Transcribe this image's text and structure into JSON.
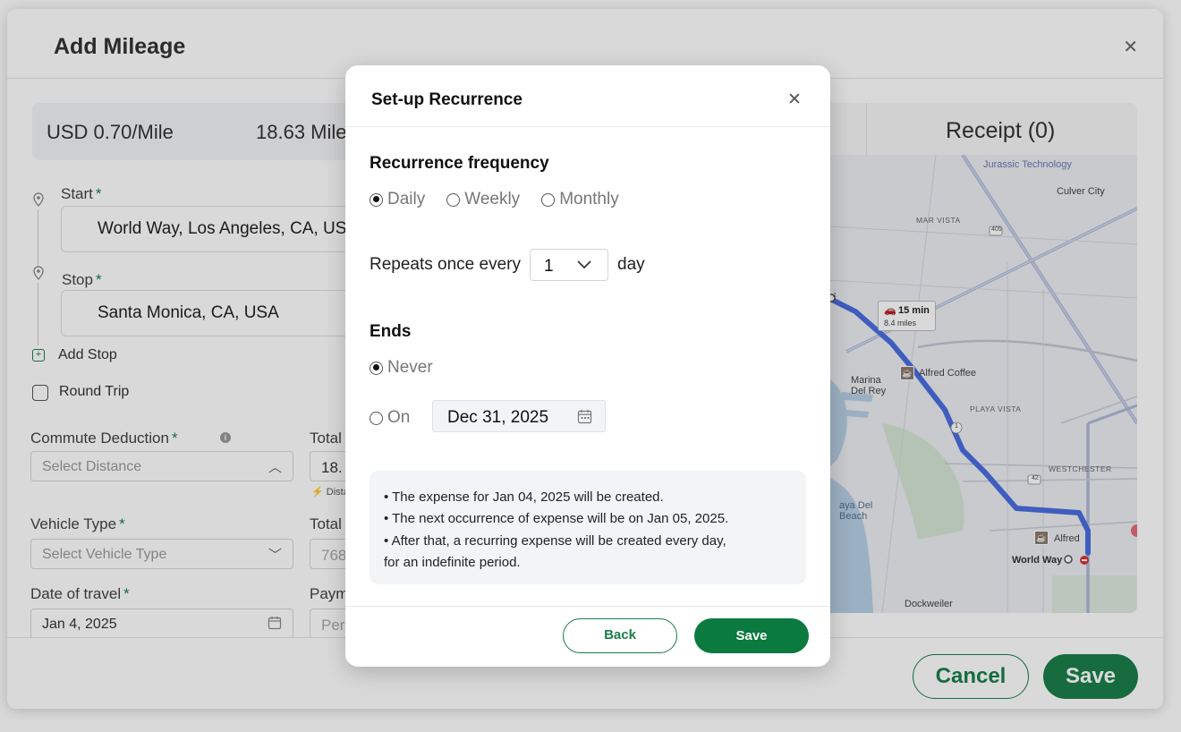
{
  "page": {
    "title": "Add Mileage",
    "close_glyph": "✕",
    "rate": "USD 0.70/Mile",
    "miles": "18.63 Miles",
    "start_label": "Start",
    "start_value": "World Way, Los Angeles, CA, USA",
    "stop_label": "Stop",
    "stop_value": "Santa Monica, CA, USA",
    "required_mark": "*",
    "add_stop": "Add Stop",
    "round_trip": "Round Trip",
    "commute_label": "Commute Deduction",
    "commute_placeholder": "Select Distance",
    "total1_label": "Total",
    "total1_value": "18.",
    "distance_note": "Dista",
    "vehicle_label": "Vehicle Type",
    "vehicle_placeholder": "Select Vehicle Type",
    "total2_label": "Total",
    "total2_value": "768",
    "date_label": "Date of travel",
    "date_value": "Jan 4, 2025",
    "payment_label": "Paym",
    "payment_value": "Per",
    "receipt_tab": "Receipt (0)",
    "cancel": "Cancel",
    "save": "Save"
  },
  "map": {
    "labels": {
      "jurassic": "Jurassic Technology",
      "culver": "Culver City",
      "mar_vista": "MAR VISTA",
      "marina": "Marina",
      "del_rey": "Del Rey",
      "playa_vista": "PLAYA VISTA",
      "alfred": "Alfred Coffee",
      "alfred2": "Alfred",
      "westchester": "WESTCHESTER",
      "playa_del": "aya Del",
      "beach": "Beach",
      "world_way": "World Way",
      "dockweiler": "Dockweiler",
      "shield_405": "405",
      "shield_1a": "1",
      "shield_1b": "1",
      "shield_42": "42"
    },
    "route_time": "15 min",
    "route_dist": "8.4 miles",
    "route_color": "#4a6ee0"
  },
  "modal": {
    "title": "Set-up Recurrence",
    "close_glyph": "✕",
    "frequency_title": "Recurrence frequency",
    "frequency_options": [
      "Daily",
      "Weekly",
      "Monthly"
    ],
    "frequency_selected": "Daily",
    "repeats_prefix": "Repeats once every",
    "repeats_value": "1",
    "repeats_unit": "day",
    "ends_title": "Ends",
    "ends_never": "Never",
    "ends_on": "On",
    "ends_selected": "Never",
    "end_date": "Dec 31, 2025",
    "note_lines": [
      "• The expense for Jan 04, 2025 will be created.",
      "• The next occurrence of expense will be on Jan 05, 2025.",
      "• After that, a recurring expense will be created every day,",
      "for an indefinite period."
    ],
    "back": "Back",
    "save": "Save"
  },
  "colors": {
    "brand_green": "#0b7a3e",
    "overlay": "rgba(0,0,0,0.15)"
  }
}
